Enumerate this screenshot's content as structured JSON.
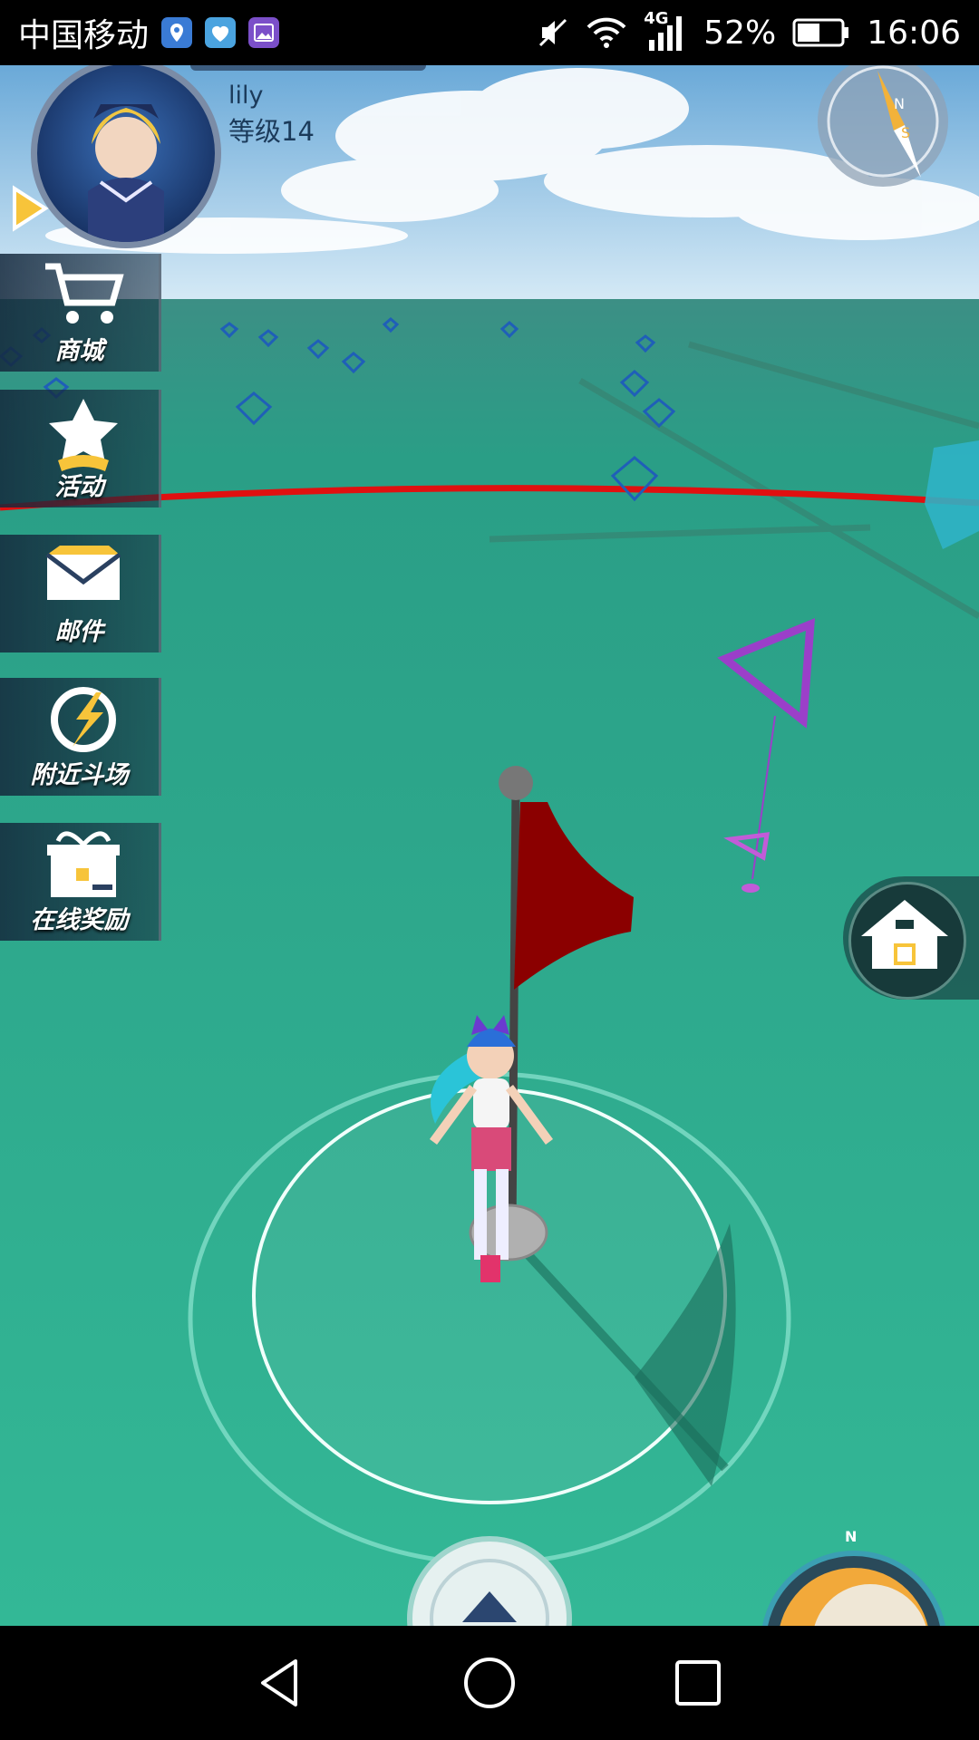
{
  "status_bar": {
    "carrier": "中国移动",
    "network": "4G",
    "battery": "52%",
    "time": "16:06"
  },
  "profile": {
    "name": "lily",
    "level": "等级14"
  },
  "sidebar": {
    "items": [
      {
        "label": "商城",
        "icon": "cart-icon"
      },
      {
        "label": "活动",
        "icon": "star-icon"
      },
      {
        "label": "邮件",
        "icon": "mail-icon"
      },
      {
        "label": "附近斗场",
        "icon": "arena-icon"
      },
      {
        "label": "在线奖励",
        "icon": "gift-icon"
      }
    ]
  },
  "compass": {
    "north": "N",
    "south": "S"
  },
  "minimap": {
    "north": "N"
  },
  "colors": {
    "ground": "#2fae8e",
    "flag": "#8b0000",
    "boundary": "#e01010",
    "sky": "#8fc4e6"
  }
}
